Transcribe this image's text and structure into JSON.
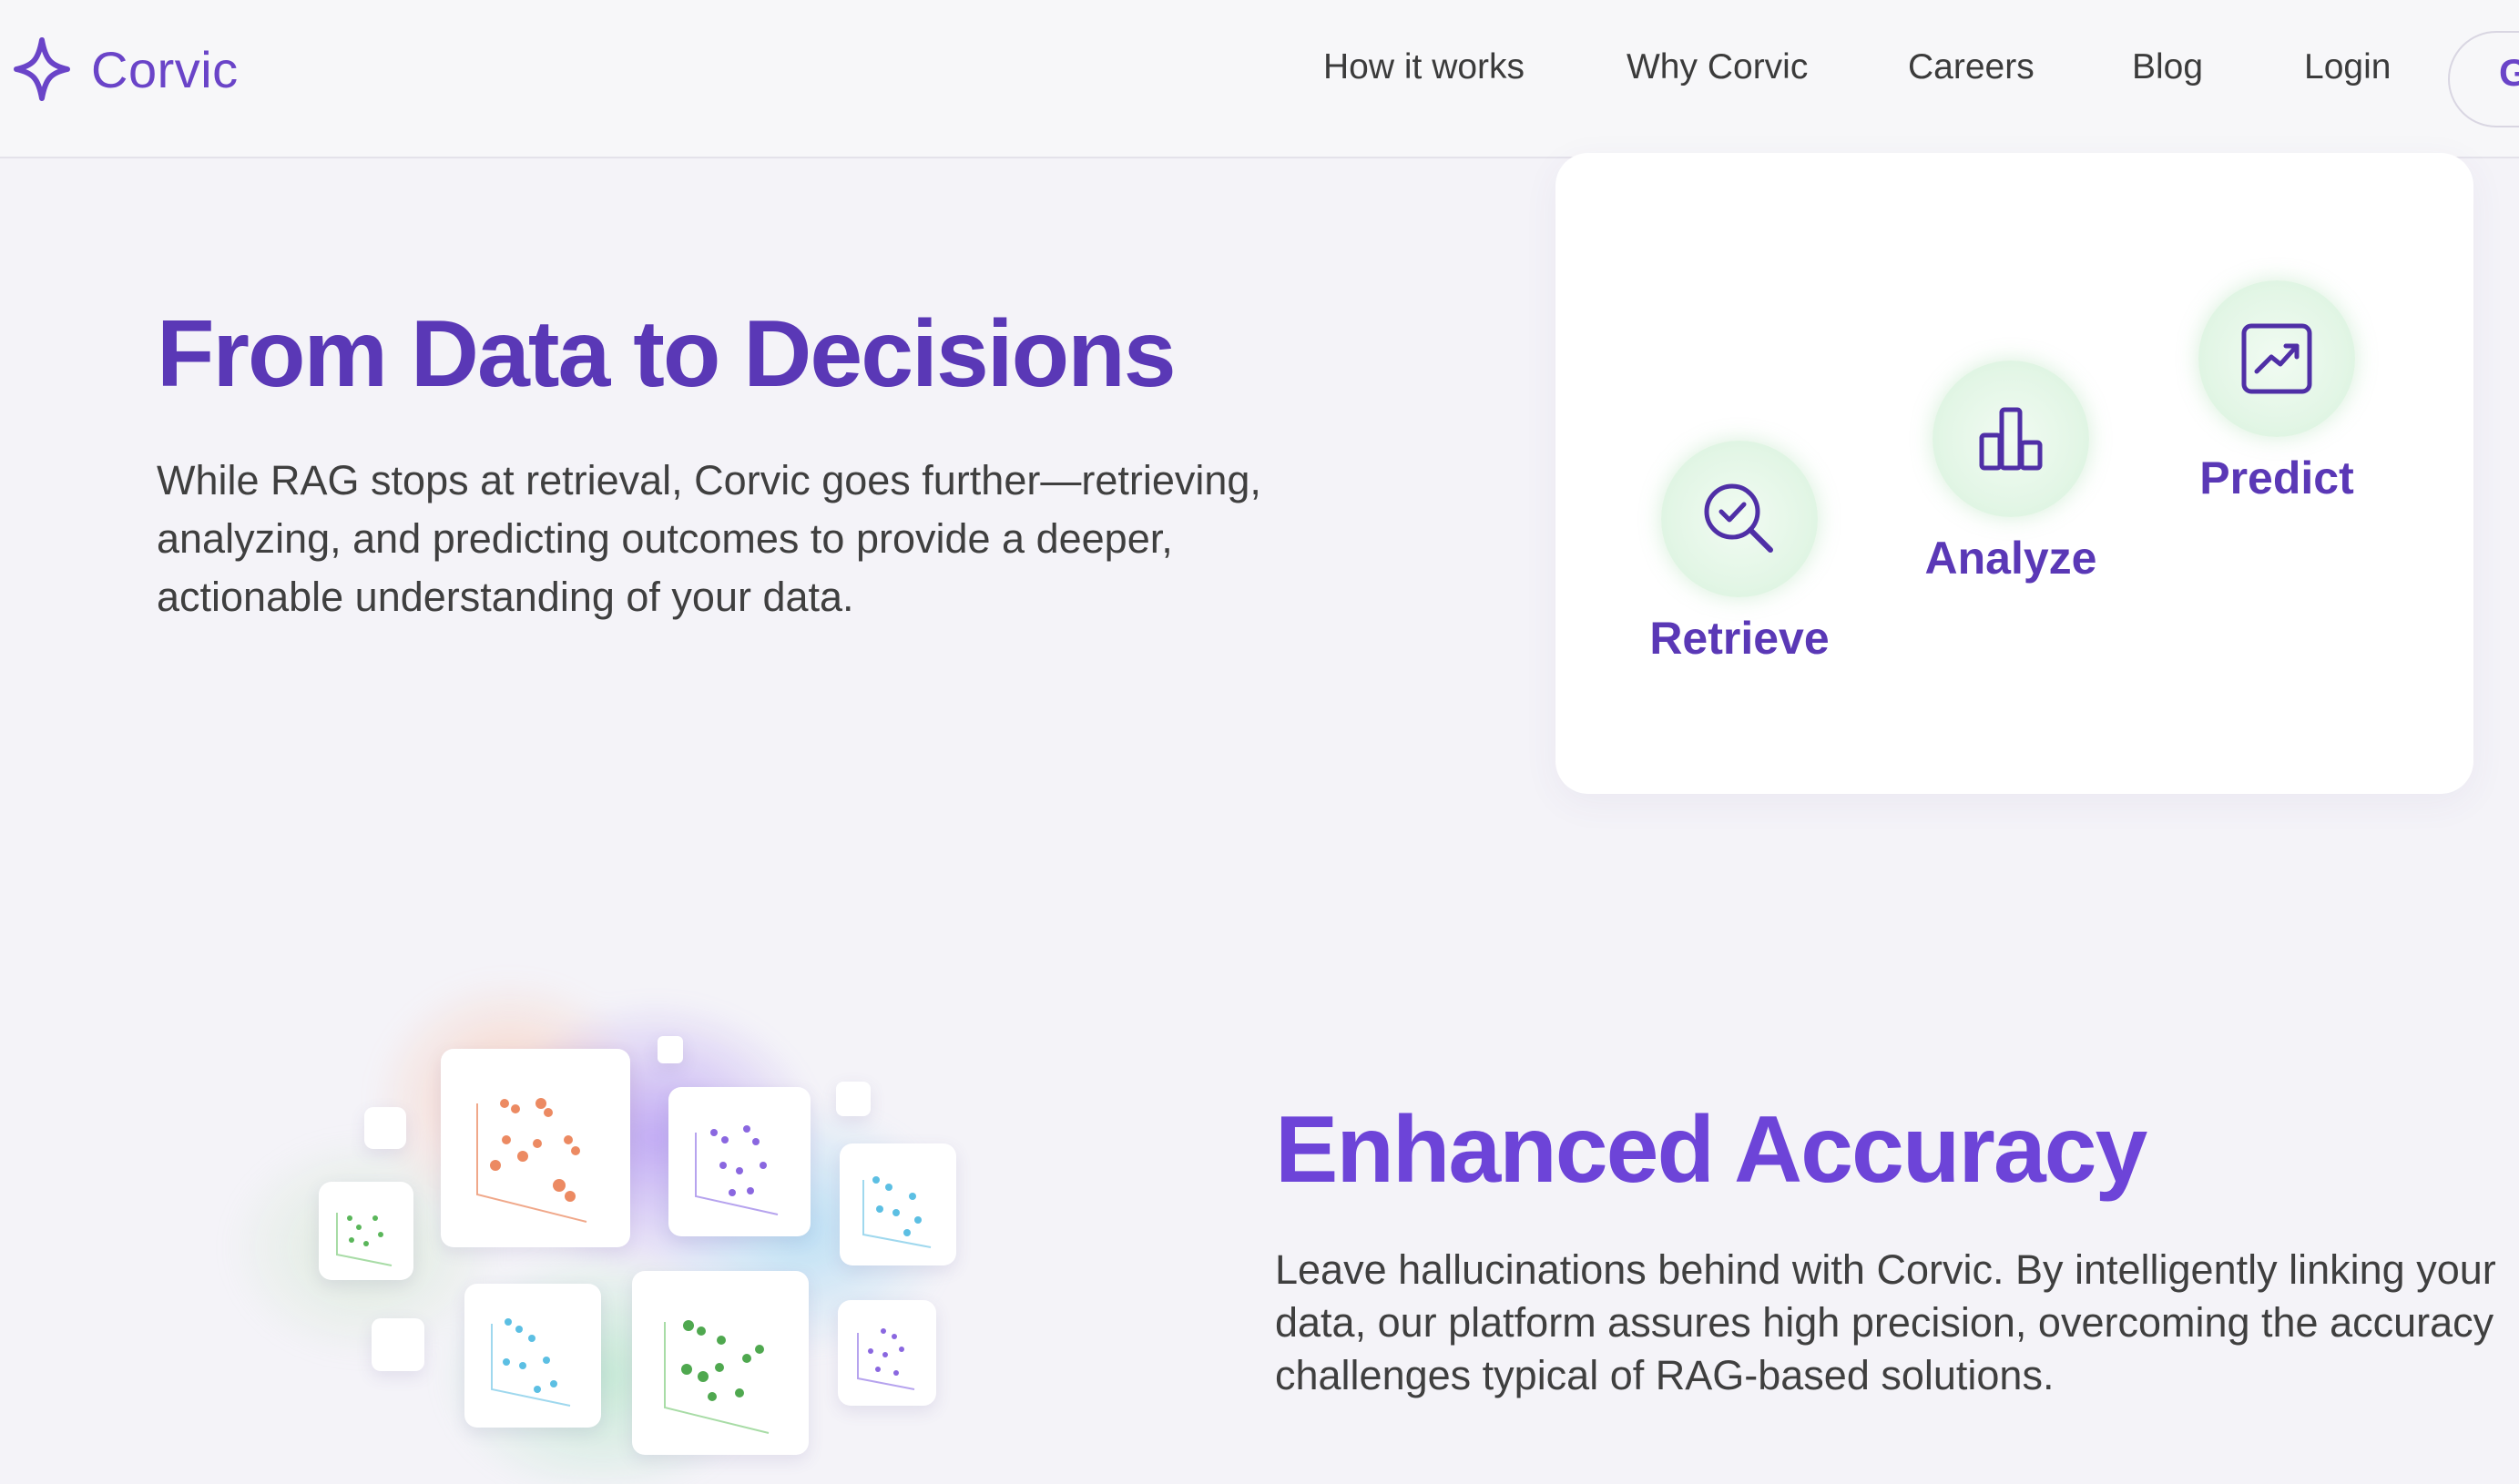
{
  "header": {
    "brand": "Corvic",
    "nav": [
      "How it works",
      "Why Corvic",
      "Careers",
      "Blog",
      "Login"
    ],
    "cta_label": "G"
  },
  "section1": {
    "title": "From Data to Decisions",
    "body": "While RAG stops at retrieval, Corvic goes further—retrieving, analyzing, and predicting outcomes to provide a deeper, actionable understanding of your data.",
    "steps": [
      {
        "label": "Retrieve",
        "icon": "magnifier-check-icon"
      },
      {
        "label": "Analyze",
        "icon": "bar-chart-icon"
      },
      {
        "label": "Predict",
        "icon": "trend-up-icon"
      }
    ]
  },
  "section2": {
    "title": "Enhanced Accuracy",
    "body": "Leave hallucinations behind with Corvic. By intelligently linking your data, our platform assures high precision, overcoming the accuracy challenges typical of RAG-based solutions."
  },
  "colors": {
    "brand": "#6a44c8",
    "heading": "#5a38b6",
    "heading_alt": "#6d44d8",
    "icon_circle": "#e3f6e6",
    "page_bg": "#f4f3f8"
  }
}
